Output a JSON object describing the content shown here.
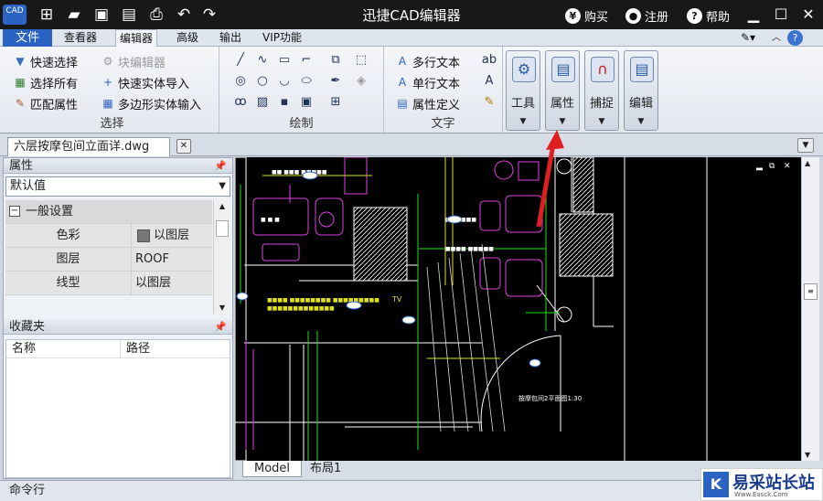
{
  "app": {
    "title": "迅捷CAD编辑器",
    "logo_text": "CAD"
  },
  "titlebar_links": {
    "buy": "购买",
    "register": "注册",
    "help": "帮助"
  },
  "tabs": {
    "file": "文件",
    "viewer": "查看器",
    "editor": "编辑器",
    "advanced": "高级",
    "output": "输出",
    "vip": "VIP功能"
  },
  "ribbon": {
    "select_group": {
      "label": "选择",
      "quick_select": "快速选择",
      "select_all": "选择所有",
      "match_props": "匹配属性",
      "block_editor": "块编辑器",
      "quick_entity_import": "快速实体导入",
      "polygon_entity_input": "多边形实体输入"
    },
    "draw_group": {
      "label": "绘制"
    },
    "text_group": {
      "label": "文字",
      "multiline_text": "多行文本",
      "single_text": "单行文本",
      "attr_define": "属性定义"
    },
    "big_buttons": {
      "tools": "工具",
      "properties": "属性",
      "snap": "捕捉",
      "edit": "编辑"
    }
  },
  "document": {
    "tab_name": "六层按摩包间立面详.dwg"
  },
  "properties_panel": {
    "title": "属性",
    "combo_value": "默认值",
    "section": "一般设置",
    "rows": [
      {
        "key": "色彩",
        "value": "以图层"
      },
      {
        "key": "图层",
        "value": "ROOF"
      },
      {
        "key": "线型",
        "value": "以图层"
      }
    ]
  },
  "favorites_panel": {
    "title": "收藏夹",
    "col_name": "名称",
    "col_path": "路径"
  },
  "layout_tabs": {
    "model": "Model",
    "layout1": "布局1"
  },
  "command_bar": {
    "label": "命令行"
  },
  "cad_labels": {
    "plan_caption": "按摩包间2平面图1:30",
    "tv": "TV"
  },
  "watermark": {
    "text": "易采站长站",
    "sub": "Www.Easck.Com"
  },
  "colors": {
    "accent": "#2a63c4",
    "titlebar": "#181818",
    "cad_bg": "#000000",
    "arrow": "#e02020"
  }
}
